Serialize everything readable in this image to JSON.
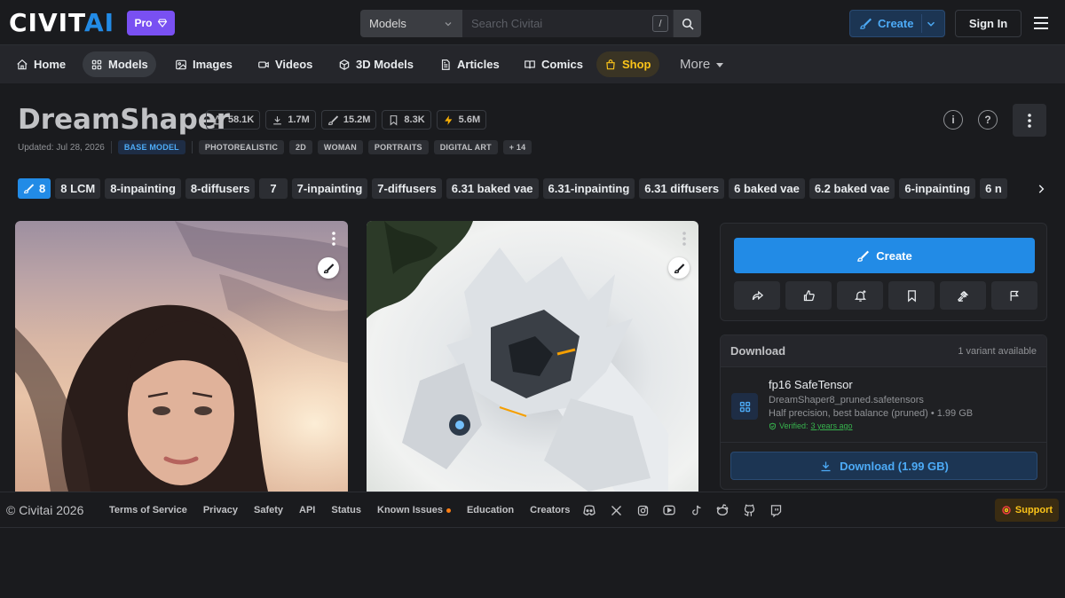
{
  "header": {
    "logo_main": "CIVIT",
    "logo_accent": "AI",
    "pro_label": "Pro",
    "search_category": "Models",
    "search_placeholder": "Search Civitai",
    "search_shortcut": "/",
    "create_label": "Create",
    "signin_label": "Sign In"
  },
  "nav": {
    "items": [
      {
        "label": "Home",
        "icon": "home-icon"
      },
      {
        "label": "Models",
        "icon": "grid-icon",
        "active": true
      },
      {
        "label": "Images",
        "icon": "image-icon"
      },
      {
        "label": "Videos",
        "icon": "video-icon"
      },
      {
        "label": "3D Models",
        "icon": "cube-icon"
      },
      {
        "label": "Articles",
        "icon": "article-icon"
      },
      {
        "label": "Comics",
        "icon": "book-icon"
      },
      {
        "label": "Shop",
        "icon": "shopping-bag-icon"
      }
    ],
    "more_label": "More"
  },
  "model": {
    "title": "DreamShaper",
    "stats": {
      "likes": "58.1K",
      "downloads": "1.7M",
      "generations": "15.2M",
      "bookmarks": "8.3K",
      "buzz": "5.6M"
    },
    "updated": "Updated: Jul 28, 2026",
    "base_tag": "BASE MODEL",
    "tags": [
      "PHOTOREALISTIC",
      "2D",
      "WOMAN",
      "PORTRAITS",
      "DIGITAL ART",
      "+ 14"
    ],
    "info_icon_label": "i",
    "help_icon_label": "?"
  },
  "versions": [
    "8",
    "8 LCM",
    "8-inpainting",
    "8-diffusers",
    "7",
    "7-inpainting",
    "7-diffusers",
    "6.31 baked vae",
    "6.31-inpainting",
    "6.31 diffusers",
    "6 baked vae",
    "6.2 baked vae",
    "6-inpainting",
    "6 n"
  ],
  "side": {
    "create_label": "Create"
  },
  "download": {
    "title": "Download",
    "variants": "1 variant available",
    "file_name": "fp16 SafeTensor",
    "file_path": "DreamShaper8_pruned.safetensors",
    "file_desc": "Half precision, best balance (pruned) • 1.99 GB",
    "verified_label": "Verified:",
    "verified_age": "3 years ago",
    "button_label": "Download (1.99 GB)"
  },
  "footer": {
    "copyright": "© Civitai 2026",
    "links": [
      "Terms of Service",
      "Privacy",
      "Safety",
      "API",
      "Status",
      "Known Issues",
      "Education",
      "Creators"
    ],
    "socials": [
      "discord-icon",
      "x-icon",
      "instagram-icon",
      "youtube-icon",
      "tiktok-icon",
      "reddit-icon",
      "github-icon",
      "twitch-icon"
    ],
    "support_label": "Support"
  },
  "colors": {
    "background": "#1a1b1e",
    "accent": "#228be6",
    "pro": "#7950f2",
    "shop": "#fcc419",
    "buzz": "#fab005",
    "verified": "#37b24d"
  }
}
